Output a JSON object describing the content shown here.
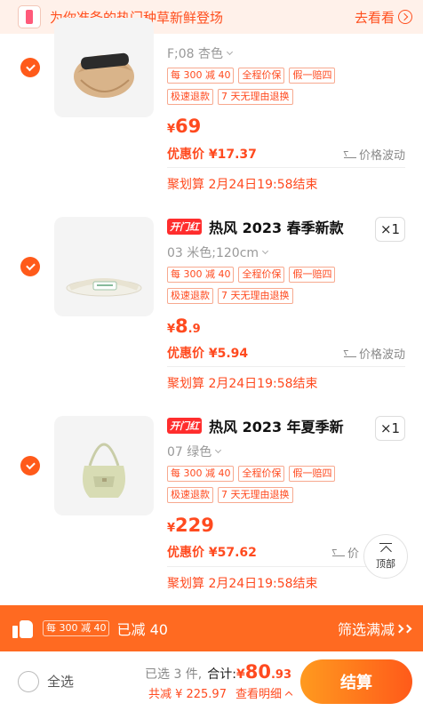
{
  "banner": {
    "text": "为你准备的热门种草新鲜登场",
    "link": "去看看"
  },
  "items": [
    {
      "sku": "F;08 杏色",
      "tags": [
        "每 300 减 40",
        "全程价保",
        "假一赔四",
        "极速退款",
        "7 天无理由退换"
      ],
      "price_symbol": "¥",
      "price_int": "69",
      "price_dec": "",
      "promo_label": "优惠价 ¥17.37",
      "price_trend": "价格波动",
      "juhuasuan": "聚划算 2月24日19:58结束"
    },
    {
      "brand_tag": "开门红",
      "title": "热风 2023 春季新款",
      "qty": "×1",
      "sku": "03 米色;120cm",
      "tags": [
        "每 300 减 40",
        "全程价保",
        "假一赔四",
        "极速退款",
        "7 天无理由退换"
      ],
      "price_symbol": "¥",
      "price_int": "8",
      "price_dec": ".9",
      "promo_label": "优惠价 ¥5.94",
      "price_trend": "价格波动",
      "juhuasuan": "聚划算 2月24日19:58结束"
    },
    {
      "brand_tag": "开门红",
      "title": "热风 2023 年夏季新",
      "qty": "×1",
      "sku": "07 绿色",
      "tags": [
        "每 300 减 40",
        "全程价保",
        "假一赔四",
        "极速退款",
        "7 天无理由退换"
      ],
      "price_symbol": "¥",
      "price_int": "229",
      "price_dec": "",
      "promo_label": "优惠价 ¥57.62",
      "price_trend": "价",
      "juhuasuan": "聚划算 2月24日19:58结束"
    }
  ],
  "to_top": "顶部",
  "promo_bar": {
    "tag": "每 300 减 40",
    "text": "已减 40",
    "right": "筛选满减"
  },
  "bottom": {
    "select_all": "全选",
    "selected": "已选 3 件,",
    "total_label": "合计:",
    "total_symbol": "¥",
    "total_int": "80",
    "total_dec": ".93",
    "saved": "共减 ¥ 225.97",
    "detail": "查看明细",
    "checkout": "结算"
  },
  "colors": {
    "accent": "#ff4a1f",
    "promo_bar": "#ff6a21",
    "check": "#ff5a1a"
  }
}
